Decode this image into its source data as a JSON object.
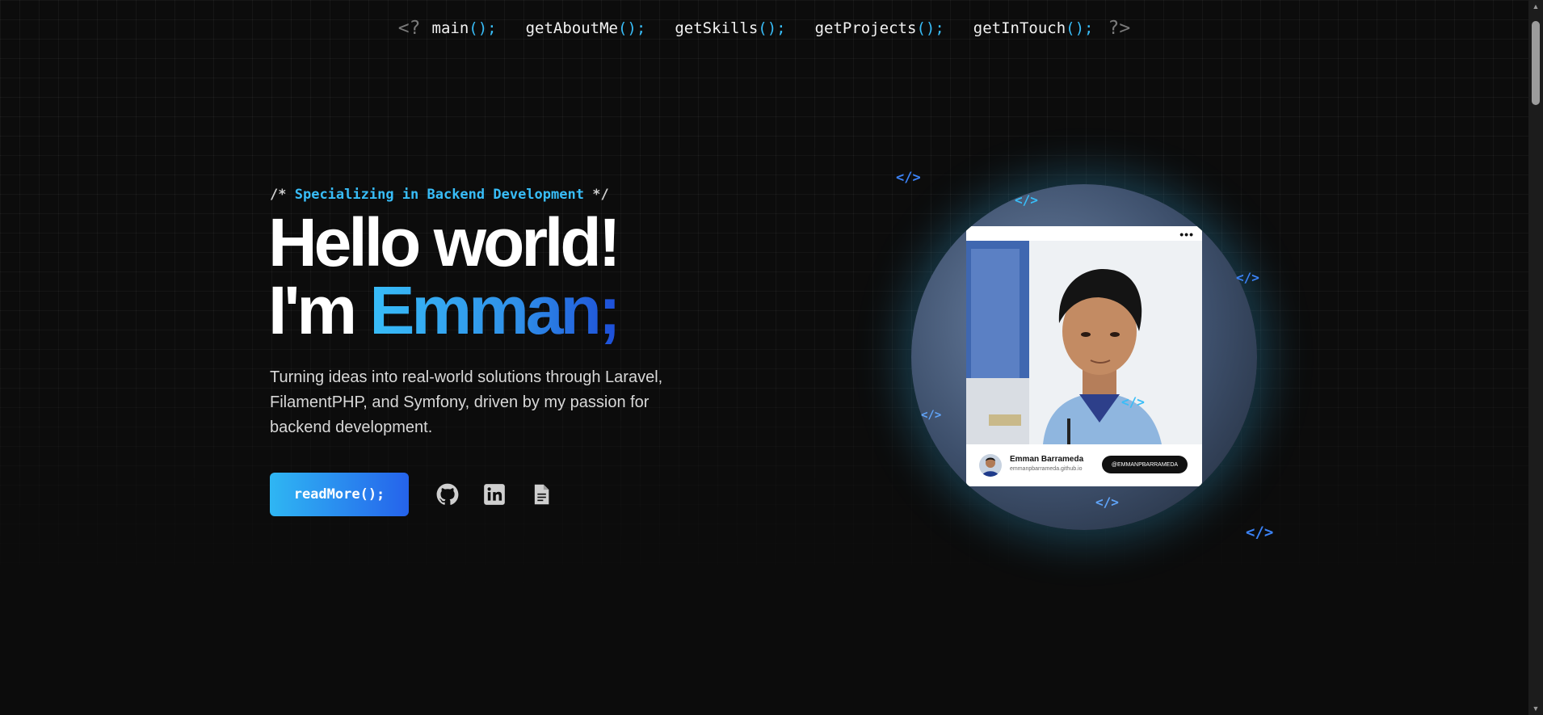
{
  "nav": {
    "open_tag": "<?",
    "close_tag": "?>",
    "items": [
      {
        "name": "main",
        "parens": "();"
      },
      {
        "name": "getAboutMe",
        "parens": "();"
      },
      {
        "name": "getSkills",
        "parens": "();"
      },
      {
        "name": "getProjects",
        "parens": "();"
      },
      {
        "name": "getInTouch",
        "parens": "();"
      }
    ]
  },
  "hero": {
    "comment_open": "/*",
    "comment_text": "Specializing in Backend Development",
    "comment_close": "*/",
    "headline_line1": "Hello world!",
    "headline_prefix": "I'm",
    "headline_name": "Emman;",
    "description": "Turning ideas into real-world solutions through Laravel, FilamentPHP, and Symfony, driven by my passion for backend development.",
    "cta_label": "readMore();"
  },
  "socials": [
    {
      "icon": "github-icon"
    },
    {
      "icon": "linkedin-icon"
    },
    {
      "icon": "document-icon"
    }
  ],
  "portrait_card": {
    "menu": "•••",
    "name": "Emman Barrameda",
    "email": "emmanpbarrameda.github.io",
    "button": "@EMMANPBARRAMEDA"
  },
  "deco_tag": "</>",
  "colors": {
    "accent": "#38bdf8",
    "accent_deep": "#2563eb",
    "background": "#0c0c0c"
  }
}
